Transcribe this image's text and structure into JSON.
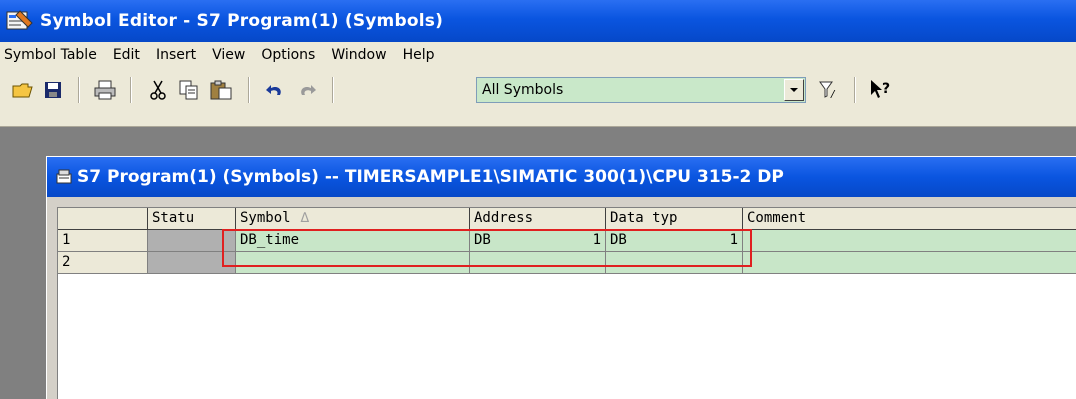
{
  "window": {
    "title": "Symbol Editor - S7 Program(1) (Symbols)"
  },
  "menu": {
    "items": [
      "Symbol Table",
      "Edit",
      "Insert",
      "View",
      "Options",
      "Window",
      "Help"
    ]
  },
  "toolbar": {
    "filter_value": "All Symbols",
    "icons": [
      "open-icon",
      "save-icon",
      "print-icon",
      "cut-icon",
      "copy-icon",
      "paste-icon",
      "undo-icon",
      "redo-icon",
      "filter-icon",
      "help-pointer-icon"
    ]
  },
  "child_window": {
    "title": "S7 Program(1) (Symbols) -- TIMERSAMPLE1\\SIMATIC 300(1)\\CPU 315-2 DP"
  },
  "table": {
    "headers": [
      "",
      "Statu",
      "Symbol",
      "Address",
      "Data typ",
      "Comment"
    ],
    "sort_indicator": "∆",
    "rows": [
      {
        "num": "1",
        "status": "",
        "symbol": "DB_time",
        "address_type": "DB",
        "address_num": "1",
        "datatype": "DB",
        "datatype_num": "1",
        "comment": ""
      },
      {
        "num": "2",
        "status": "",
        "symbol": "",
        "address_type": "",
        "address_num": "",
        "datatype": "",
        "datatype_num": "",
        "comment": ""
      }
    ]
  },
  "colors": {
    "titlebar": "#0a55e0",
    "row_fill": "#c8e6c8",
    "highlight": "#e02020"
  }
}
